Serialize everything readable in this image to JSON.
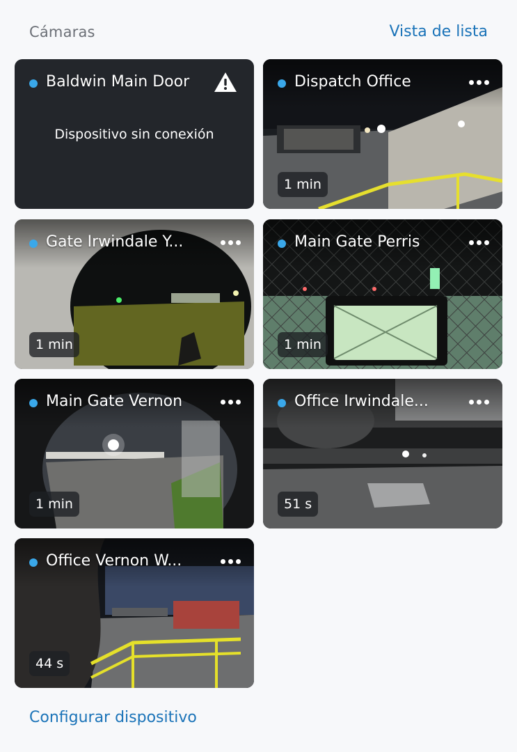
{
  "header": {
    "title": "Cámaras",
    "list_view_label": "Vista de lista"
  },
  "cameras": [
    {
      "name": "Baldwin Main Door",
      "status": "Dispositivo sin conexión",
      "icon": "warning-icon"
    },
    {
      "name": "Dispatch Office",
      "age": "1 min"
    },
    {
      "name": "Gate Irwindale Y...",
      "age": "1 min"
    },
    {
      "name": "Main Gate Perris",
      "age": "1 min"
    },
    {
      "name": "Main Gate Vernon",
      "age": "1 min"
    },
    {
      "name": "Office Irwindale...",
      "age": "51 s"
    },
    {
      "name": "Office Vernon W...",
      "age": "44 s"
    }
  ],
  "footer": {
    "setup_label": "Configurar dispositivo"
  },
  "colors": {
    "accent": "#1a73b8",
    "status_dot": "#3aa8ea",
    "card_bg": "#23262b",
    "page_bg": "#f7f8fa"
  }
}
